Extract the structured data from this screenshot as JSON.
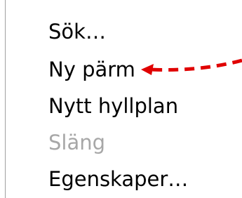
{
  "menu": {
    "items": [
      {
        "label": "Sök…",
        "enabled": true
      },
      {
        "label": "Ny pärm",
        "enabled": true
      },
      {
        "label": "Nytt hyllplan",
        "enabled": true
      },
      {
        "label": "Släng",
        "enabled": false
      },
      {
        "label": "Egenskaper…",
        "enabled": true
      }
    ]
  },
  "annotation": {
    "arrow_color": "#e00000",
    "arrow_style": "dashed",
    "points_to": "Ny pärm"
  },
  "colors": {
    "text": "#000000",
    "disabled_text": "#a7a7a7",
    "background": "#ffffff",
    "menu_border": "#a0a0a0"
  }
}
